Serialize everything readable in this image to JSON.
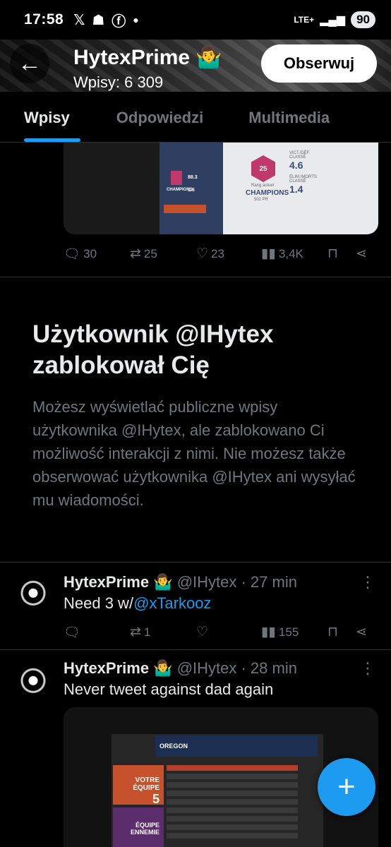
{
  "status_bar": {
    "time": "17:58",
    "notification_icons": [
      "x-icon",
      "person-icon",
      "facebook-icon",
      "dot-icon"
    ],
    "network": "LTE+",
    "battery": "90"
  },
  "header": {
    "name": "HytexPrime 🤷‍♂️",
    "post_count": "Wpisy: 6 309",
    "follow_label": "Obserwuj",
    "back_icon": "arrow-left-icon"
  },
  "tabs": [
    {
      "label": "Wpisy",
      "active": true
    },
    {
      "label": "Odpowiedzi",
      "active": false
    },
    {
      "label": "Multimedia",
      "active": false
    }
  ],
  "top_media": {
    "rank_number": "25",
    "rank_label": "Rang actuel",
    "rank_name": "CHAMPIONS",
    "rank_pr": "502 PR",
    "stat1_label": "VICT./DÉF. CLASSÉ",
    "stat1_value": "4.6",
    "stat2_label": "ÉLIM./MORTS CLASSÉ",
    "stat2_value": "1.4",
    "left_rank": "CHAMPIONS",
    "left_value1": "88.3",
    "left_value2": "1.6"
  },
  "top_actions": {
    "replies": "30",
    "reposts": "25",
    "likes": "23",
    "views": "3,4K"
  },
  "blocked": {
    "title": "Użytkownik @IHytex zablokował Cię",
    "body": "Możesz wyświetlać publiczne wpisy użytkownika @IHytex, ale zablokowano Ci możliwość interakcji z nimi. Nie możesz także obserwować użytkownika @IHytex ani wysyłać mu wiadomości."
  },
  "tweets": [
    {
      "name": "HytexPrime 🤷‍♂️",
      "handle": "@IHytex · 27 min",
      "text_prefix": "Need 3 w/",
      "mention": "@xTarkooz",
      "reposts": "1",
      "views": "155"
    },
    {
      "name": "HytexPrime 🤷‍♂️",
      "handle": "@IHytex · 28 min",
      "text": "Never tweet against dad again",
      "media_team_header": "OREGON",
      "media_team1": "VOTRE ÉQUIPE",
      "media_team1_score": "5",
      "media_team2": "ÉQUIPE ENNEMIE"
    }
  ],
  "fab_label": "+",
  "colors": {
    "accent": "#1d9bf0",
    "background": "#000000",
    "text_primary": "#e7e9ea",
    "text_secondary": "#71767b"
  }
}
